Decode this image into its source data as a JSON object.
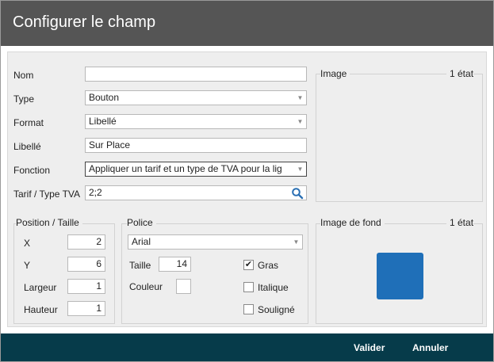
{
  "dialog": {
    "title": "Configurer le champ"
  },
  "form": {
    "nom": {
      "label": "Nom",
      "value": ""
    },
    "type": {
      "label": "Type",
      "value": "Bouton"
    },
    "format": {
      "label": "Format",
      "value": "Libellé"
    },
    "libelle": {
      "label": "Libellé",
      "value": "Sur Place"
    },
    "fonction": {
      "label": "Fonction",
      "value": "Appliquer un tarif et un type de TVA pour la lig"
    },
    "tarif": {
      "label": "Tarif / Type TVA",
      "value": "2;2"
    }
  },
  "image_group": {
    "title": "Image",
    "state": "1 état"
  },
  "position": {
    "title": "Position / Taille",
    "x": {
      "label": "X",
      "value": "2"
    },
    "y": {
      "label": "Y",
      "value": "6"
    },
    "largeur": {
      "label": "Largeur",
      "value": "1"
    },
    "hauteur": {
      "label": "Hauteur",
      "value": "1"
    }
  },
  "police": {
    "title": "Police",
    "font": "Arial",
    "taille": {
      "label": "Taille",
      "value": "14"
    },
    "couleur": {
      "label": "Couleur"
    },
    "gras": {
      "label": "Gras",
      "checked": true,
      "mark": "✔"
    },
    "italique": {
      "label": "Italique",
      "checked": false
    },
    "souligne": {
      "label": "Souligné",
      "checked": false
    }
  },
  "background_group": {
    "title": "Image de fond",
    "state": "1 état",
    "swatch_color": "#1f6fb8"
  },
  "footer": {
    "valider": "Valider",
    "annuler": "Annuler",
    "bg_color": "#063b4a"
  },
  "icons": {
    "dropdown": "chevron-down-icon",
    "search": "search-icon",
    "check": "check-icon"
  }
}
